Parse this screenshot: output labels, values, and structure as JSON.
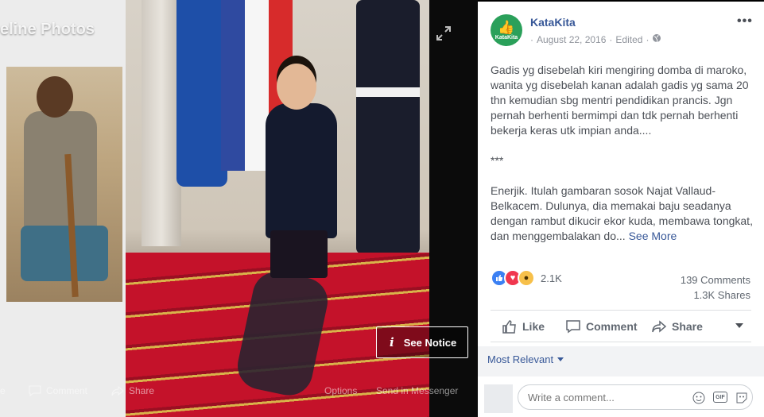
{
  "photo": {
    "album_title": "eline Photos",
    "notice_label": "See Notice",
    "actions": [
      "e",
      "Comment",
      "Share",
      "Options",
      "Send in Messenger"
    ]
  },
  "post": {
    "page_name": "KataKita",
    "avatar_label": "KataKita",
    "date": "August 22, 2016",
    "edited": "Edited",
    "more": "•••",
    "caption_p1": "Gadis yg disebelah kiri mengiring domba di maroko, wanita yg disebelah kanan adalah gadis yg sama 20 thn kemudian sbg mentri pendidikan prancis. Jgn pernah berhenti bermimpi dan tdk pernah berhenti bekerja keras utk impian anda....",
    "caption_p2": "***",
    "caption_p3": "Enerjik. Itulah gambaran sosok Najat Vallaud-Belkacem. Dulunya, dia memakai baju seadanya dengan rambut dikucir ekor kuda, membawa tongkat, dan menggembalakan do...",
    "see_more": "See More",
    "reaction_count": "2.1K",
    "comments_count": "139 Comments",
    "shares_count": "1.3K Shares"
  },
  "actions": {
    "like": "Like",
    "comment": "Comment",
    "share": "Share"
  },
  "comments": {
    "sort": "Most Relevant",
    "placeholder": "Write a comment..."
  },
  "colors": {
    "link": "#385898",
    "avatar_green": "#2aa05a",
    "like_blue": "#3b80f3",
    "love_red": "#f0374e",
    "wow_yellow": "#f7c04a"
  }
}
